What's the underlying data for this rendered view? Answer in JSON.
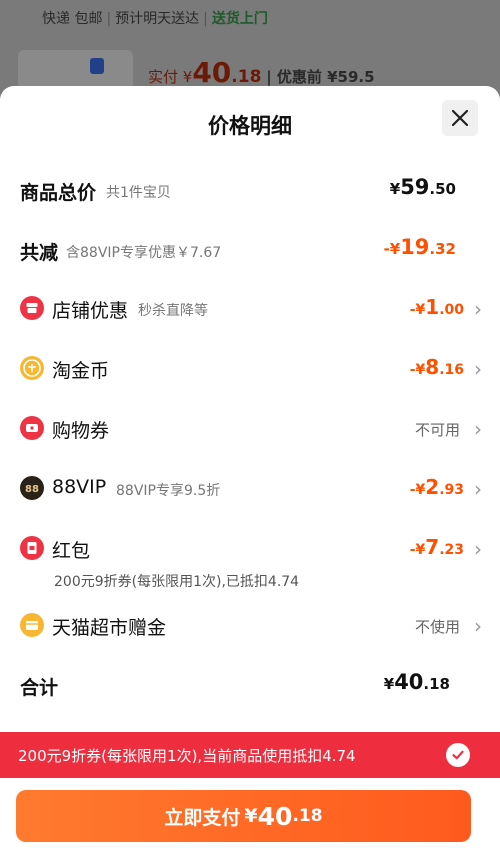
{
  "background": {
    "shipping": "快递 包邮",
    "delivery": "预计明天送达",
    "door": "送货上门",
    "actual_label": "实付 ¥",
    "actual_int": "40",
    "actual_dec": ".18",
    "before_label": "优惠前 ¥59.5"
  },
  "sheet": {
    "title": "价格明细",
    "close_icon": "close-icon"
  },
  "rows": {
    "total": {
      "label": "商品总价",
      "sub": "共1件宝贝",
      "currency": "¥",
      "int": "59",
      "dec": ".50"
    },
    "reduce": {
      "label": "共减",
      "sub": "含88VIP专享优惠￥7.67",
      "prefix": "-¥",
      "int": "19",
      "dec": ".32"
    },
    "shop": {
      "label": "店铺优惠",
      "sub": "秒杀直降等",
      "prefix": "-¥",
      "int": "1",
      "dec": ".00"
    },
    "coin": {
      "label": "淘金币",
      "prefix": "-¥",
      "int": "8",
      "dec": ".16"
    },
    "voucher": {
      "label": "购物券",
      "status": "不可用"
    },
    "vip": {
      "label": "88VIP",
      "sub": "88VIP专享9.5折",
      "prefix": "-¥",
      "int": "2",
      "dec": ".93"
    },
    "redpacket": {
      "label": "红包",
      "prefix": "-¥",
      "int": "7",
      "dec": ".23",
      "note": "200元9折券(每张限用1次),已抵扣4.74"
    },
    "tmall": {
      "label": "天猫超市赠金",
      "status": "不使用"
    },
    "sum": {
      "label": "合计",
      "currency": "¥",
      "int": "40",
      "dec": ".18"
    }
  },
  "banner": {
    "text": "200元9折券(每张限用1次),当前商品使用抵扣4.74"
  },
  "pay": {
    "label": "立即支付",
    "currency": "¥",
    "int": "40",
    "dec": ".18"
  },
  "colors": {
    "accent": "#ff5000",
    "banner": "#ee2e3f",
    "pay_button": "#ff6a24"
  }
}
